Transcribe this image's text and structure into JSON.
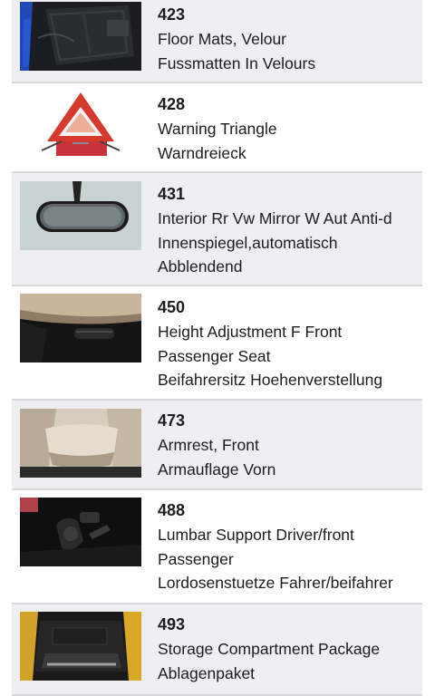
{
  "options": [
    {
      "code": "423",
      "lines": [
        "Floor Mats, Velour",
        "Fussmatten In Velours"
      ],
      "image_icon": "floor-mats-image"
    },
    {
      "code": "428",
      "lines": [
        "Warning Triangle",
        "Warndreieck"
      ],
      "image_icon": "warning-triangle-image"
    },
    {
      "code": "431",
      "lines": [
        "Interior Rr Vw Mirror W Aut Anti-d",
        "Innenspiegel,automatisch",
        "Abblendend"
      ],
      "image_icon": "rearview-mirror-image"
    },
    {
      "code": "450",
      "lines": [
        "Height Adjustment F Front",
        "Passenger Seat",
        "Beifahrersitz Hoehenverstellung"
      ],
      "image_icon": "seat-height-adjustment-image"
    },
    {
      "code": "473",
      "lines": [
        "Armrest, Front",
        "Armauflage Vorn"
      ],
      "image_icon": "armrest-image"
    },
    {
      "code": "488",
      "lines": [
        "Lumbar Support Driver/front",
        "Passenger",
        "Lordosenstuetze Fahrer/beifahrer"
      ],
      "image_icon": "lumbar-support-image"
    },
    {
      "code": "493",
      "lines": [
        "Storage Compartment Package",
        "Ablagenpaket"
      ],
      "image_icon": "storage-compartment-image"
    }
  ],
  "colors": {
    "row_gray": "#efeff1",
    "row_white": "#ffffff",
    "divider": "#d9d9db",
    "text": "#1c1c1e"
  }
}
